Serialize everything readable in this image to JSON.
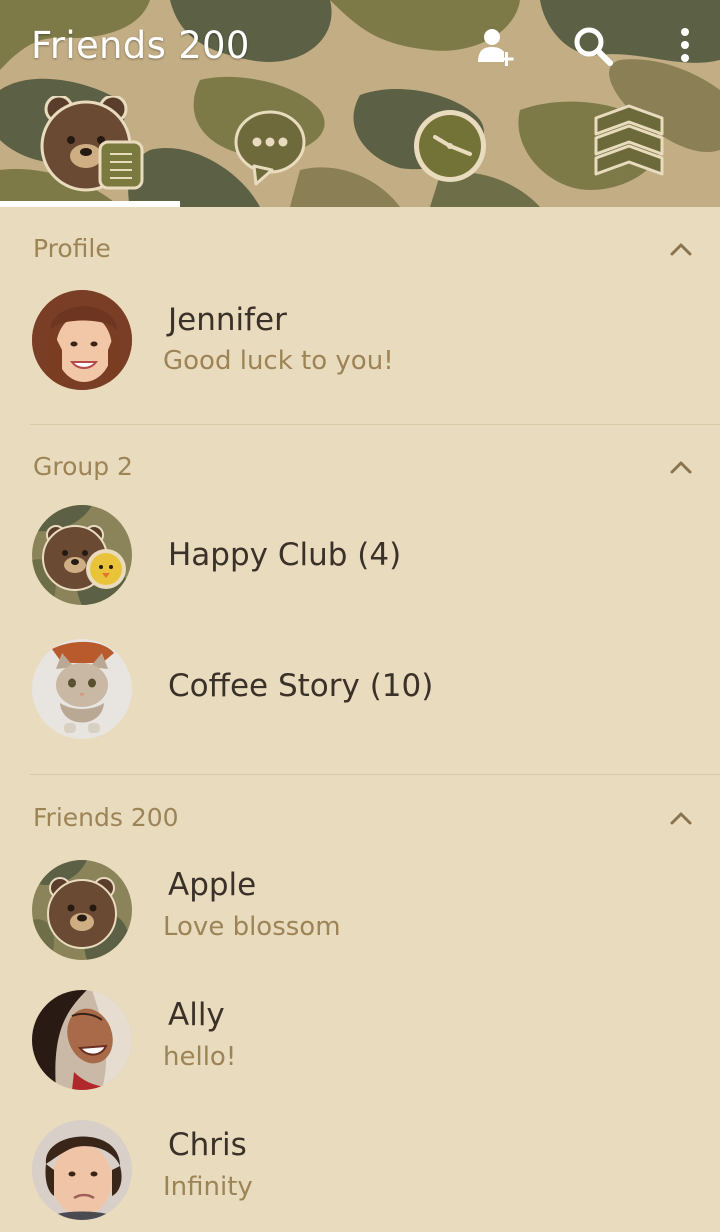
{
  "header": {
    "title": "Friends 200",
    "actions": [
      {
        "icon": "add-friend-icon"
      },
      {
        "icon": "search-icon"
      },
      {
        "icon": "more-options-icon"
      }
    ],
    "tabs": [
      {
        "icon": "friends-tab-icon",
        "selected": true
      },
      {
        "icon": "chats-tab-icon",
        "selected": false
      },
      {
        "icon": "timeline-tab-icon",
        "selected": false
      },
      {
        "icon": "more-tab-icon",
        "selected": false
      }
    ]
  },
  "sections": {
    "profile": {
      "title": "Profile",
      "items": [
        {
          "name": "Jennifer",
          "status": "Good luck to you!"
        }
      ]
    },
    "groups": {
      "title": "Group 2",
      "items": [
        {
          "name": "Happy Club (4)"
        },
        {
          "name": "Coffee Story (10)"
        }
      ]
    },
    "friends": {
      "title": "Friends 200",
      "items": [
        {
          "name": "Apple",
          "status": "Love blossom"
        },
        {
          "name": "Ally",
          "status": "hello!"
        },
        {
          "name": "Chris",
          "status": "Infinity"
        }
      ]
    }
  },
  "colors": {
    "background": "#e9dbbd",
    "section_title": "#9c8457",
    "name_text": "#3a3128",
    "status_text": "#9c8457",
    "camo_olive": "#7d7a48",
    "camo_dark": "#5a5e43",
    "camo_tan": "#c7b48a"
  }
}
